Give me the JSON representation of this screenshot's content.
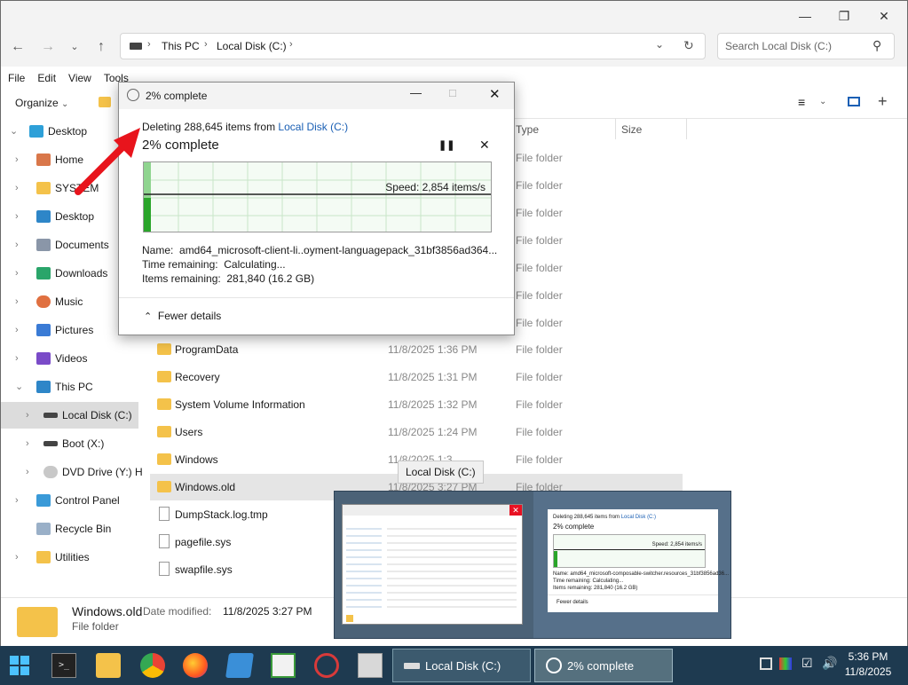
{
  "explorer": {
    "address_segments": [
      "This PC",
      "Local Disk (C:)"
    ],
    "search_placeholder": "Search Local Disk (C:)",
    "menu": [
      "File",
      "Edit",
      "View",
      "Tools"
    ],
    "organize_label": "Organize",
    "columns": {
      "type": "Type",
      "size": "Size"
    },
    "sidebar": [
      {
        "label": "Desktop",
        "icon": "desktop-icon"
      },
      {
        "label": "Home",
        "icon": "home-icon"
      },
      {
        "label": "SYSTEM",
        "icon": "folder-icon"
      },
      {
        "label": "Desktop",
        "icon": "desktop-icon"
      },
      {
        "label": "Documents",
        "icon": "documents-icon"
      },
      {
        "label": "Downloads",
        "icon": "downloads-icon"
      },
      {
        "label": "Music",
        "icon": "music-icon"
      },
      {
        "label": "Pictures",
        "icon": "pictures-icon"
      },
      {
        "label": "Videos",
        "icon": "videos-icon"
      },
      {
        "label": "This PC",
        "icon": "pc-icon"
      },
      {
        "label": "Local Disk (C:)",
        "icon": "drive-icon"
      },
      {
        "label": "Boot (X:)",
        "icon": "drive-icon"
      },
      {
        "label": "DVD Drive (Y:) H",
        "icon": "dvd-icon"
      },
      {
        "label": "Control Panel",
        "icon": "control-panel-icon"
      },
      {
        "label": "Recycle Bin",
        "icon": "recycle-bin-icon"
      },
      {
        "label": "Utilities",
        "icon": "folder-icon"
      }
    ],
    "hidden_rows_type": [
      "File folder",
      "File folder",
      "File folder",
      "File folder",
      "File folder",
      "File folder",
      "File folder"
    ],
    "files": [
      {
        "name": "ProgramData",
        "date": "11/8/2025 1:36 PM",
        "type": "File folder"
      },
      {
        "name": "Recovery",
        "date": "11/8/2025 1:31 PM",
        "type": "File folder"
      },
      {
        "name": "System Volume Information",
        "date": "11/8/2025 1:32 PM",
        "type": "File folder"
      },
      {
        "name": "Users",
        "date": "11/8/2025 1:24 PM",
        "type": "File folder"
      },
      {
        "name": "Windows",
        "date": "11/8/2025 1:3",
        "type": "File folder"
      },
      {
        "name": "Windows.old",
        "date": "11/8/2025 3:27 PM",
        "type": "File folder"
      },
      {
        "name": "DumpStack.log.tmp",
        "date": "",
        "type": ""
      },
      {
        "name": "pagefile.sys",
        "date": "",
        "type": ""
      },
      {
        "name": "swapfile.sys",
        "date": "",
        "type": ""
      }
    ],
    "details": {
      "name": "Windows.old",
      "date_label": "Date modified:",
      "date_value": "11/8/2025 3:27 PM",
      "type": "File folder"
    }
  },
  "dialog": {
    "title": "2% complete",
    "deleting_prefix": "Deleting 288,645 items from ",
    "deleting_location": "Local Disk (C:)",
    "heading": "2% complete",
    "progress": 0.02,
    "speed": "Speed: 2,854 items/s",
    "name_label": "Name:",
    "name_value": "amd64_microsoft-client-li..oyment-languagepack_31bf3856ad364...",
    "time_label": "Time remaining:",
    "time_value": "Calculating...",
    "items_label": "Items remaining:",
    "items_value": "281,840 (16.2 GB)",
    "fewer_details": "Fewer details"
  },
  "tooltip": "Local Disk (C:)",
  "preview": {
    "deleting_prefix": "Deleting 288,645 items from ",
    "deleting_location": "Local Disk (C:)",
    "heading": "2% complete",
    "speed": "Speed: 2,854 items/s",
    "name": "Name:  amd64_microsoft-composable-switcher.resources_31bf3856ad36...",
    "time": "Time remaining:  Calculating...",
    "items": "Items remaining:  281,840 (16.2 GB)",
    "fewer_details": "Fewer details"
  },
  "taskbar": {
    "tasks": [
      {
        "label": "Local Disk (C:)",
        "icon": "drive-icon"
      },
      {
        "label": "2% complete",
        "icon": "clock-icon"
      }
    ],
    "time": "5:36 PM",
    "date": "11/8/2025"
  },
  "colors": {
    "accent_link": "#1a5fb4",
    "arrow": "#e8141c",
    "progress_green": "#2aa52a",
    "taskbar": "#1e3a50"
  }
}
